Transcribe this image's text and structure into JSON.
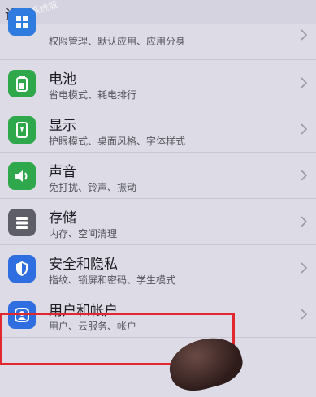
{
  "header": {
    "title": "设置",
    "watermark": "系统城"
  },
  "items": [
    {
      "name": "",
      "subtitle": "权限管理、默认应用、应用分身",
      "icon": "apps-icon",
      "color": "#2f7be0"
    },
    {
      "name": "电池",
      "subtitle": "省电模式、耗电排行",
      "icon": "battery-icon",
      "color": "#2ea84a"
    },
    {
      "name": "显示",
      "subtitle": "护眼模式、桌面风格、字体样式",
      "icon": "display-icon",
      "color": "#2ea84a"
    },
    {
      "name": "声音",
      "subtitle": "免打扰、铃声、振动",
      "icon": "sound-icon",
      "color": "#2ea84a"
    },
    {
      "name": "存储",
      "subtitle": "内存、空间清理",
      "icon": "storage-icon",
      "color": "#5d5e68"
    },
    {
      "name": "安全和隐私",
      "subtitle": "指纹、锁屏和密码、学生模式",
      "icon": "shield-icon",
      "color": "#2f6ee0"
    },
    {
      "name": "用户和帐户",
      "subtitle": "用户、云服务、帐户",
      "icon": "user-icon",
      "color": "#2f6ee0"
    }
  ],
  "highlight_color": "#e0282e"
}
